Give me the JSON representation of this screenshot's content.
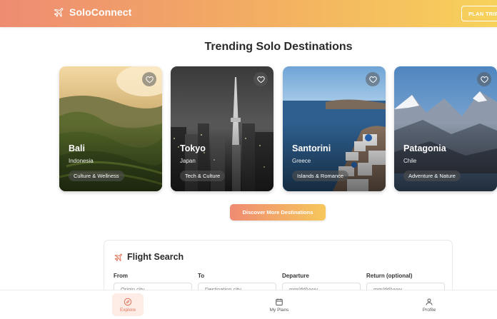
{
  "header": {
    "brand": "SoloConnect",
    "cta": "PLAN TRIP"
  },
  "section_title": "Trending Solo Destinations",
  "destinations": [
    {
      "name": "Bali",
      "country": "Indonesia",
      "tag": "Culture & Wellness"
    },
    {
      "name": "Tokyo",
      "country": "Japan",
      "tag": "Tech & Culture"
    },
    {
      "name": "Santorini",
      "country": "Greece",
      "tag": "Islands & Romance"
    },
    {
      "name": "Patagonia",
      "country": "Chile",
      "tag": "Adventure & Nature"
    }
  ],
  "discover_button": "Discover More Destinations",
  "flight_search": {
    "title": "Flight Search",
    "fields": [
      {
        "label": "From",
        "placeholder": "Origin city"
      },
      {
        "label": "To",
        "placeholder": "Destination city"
      },
      {
        "label": "Departure",
        "placeholder": "mm/dd/yyyy"
      },
      {
        "label": "Return (optional)",
        "placeholder": "mm/dd/yyyy"
      }
    ]
  },
  "nav": [
    {
      "label": "Explore",
      "icon": "compass-icon",
      "active": true
    },
    {
      "label": "My Plans",
      "icon": "calendar-icon",
      "active": false
    },
    {
      "label": "Profile",
      "icon": "user-icon",
      "active": false
    }
  ],
  "colors": {
    "gradient_start": "#ee8c72",
    "gradient_end": "#f7d25b",
    "accent": "#e0735a"
  }
}
